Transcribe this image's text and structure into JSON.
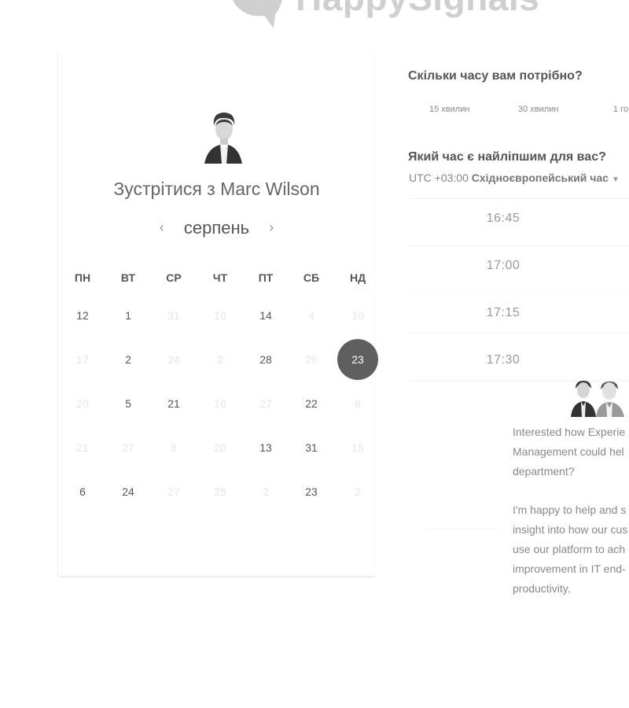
{
  "brand": {
    "logo_text": "HappySignals",
    "logo_color": "#cfcfcf"
  },
  "booking": {
    "meet_title": "Зустрітися з Marc Wilson",
    "month": "серпень",
    "prev_icon": "chevron-left-icon",
    "next_icon": "chevron-right-icon",
    "weekdays": [
      "ПН",
      "ВТ",
      "СР",
      "ЧТ",
      "ПТ",
      "СБ",
      "НД"
    ],
    "weeks": [
      [
        "12",
        "1",
        "31",
        "10",
        "14",
        "4",
        "10"
      ],
      [
        "17",
        "2",
        "24",
        "2",
        "28",
        "26",
        "23"
      ],
      [
        "20",
        "5",
        "21",
        "16",
        "27",
        "22",
        "6"
      ],
      [
        "21",
        "27",
        "8",
        "20",
        "13",
        "31",
        "15"
      ],
      [
        "6",
        "24",
        "27",
        "25",
        "2",
        "23",
        "2"
      ]
    ],
    "selected_day": "23",
    "selected_color": "#5f5f5f"
  },
  "duration": {
    "question": "Скільки часу вам потрібно?",
    "options": [
      "15 хвилин",
      "30 хвилин",
      "1 го"
    ]
  },
  "time": {
    "question": "Який час є найліпшим для вас?",
    "timezone_offset": "UTC +03:00",
    "timezone_name": "Східноєвропейський час",
    "slots": [
      "16:45",
      "17:00",
      "17:15",
      "17:30"
    ]
  },
  "promo": {
    "paragraph1": [
      "Interested how Experie",
      "Management could hel",
      "department?"
    ],
    "paragraph2": [
      "I'm happy to help and s",
      "insight into how our cus",
      "use our platform to ach",
      "improvement in IT end-",
      "productivity."
    ]
  }
}
